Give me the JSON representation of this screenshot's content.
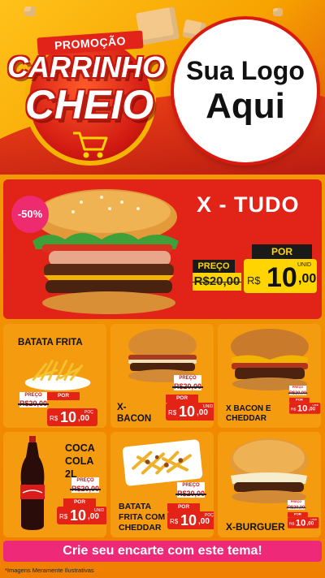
{
  "header": {
    "promo_ribbon": "PROMOÇÃO",
    "title_line1": "CARRINHO",
    "title_line2": "CHEIO",
    "logo_line1": "Sua Logo",
    "logo_line2": "Aqui"
  },
  "featured": {
    "discount": "-50%",
    "name": "X - TUDO",
    "old_label": "PREÇO",
    "old_price": "R$20,00",
    "new_label": "POR",
    "currency": "R$",
    "price_int": "10",
    "price_dec": ",00",
    "unit": "UNID"
  },
  "products": [
    {
      "name": "BATATA FRITA",
      "plabel": "PREÇO",
      "pold": "R$20,00",
      "por": "POR",
      "cur": "R$",
      "int": "10",
      "dec": ",00",
      "unit": "POÇ"
    },
    {
      "name": "X-BACON",
      "name_l1": "X-",
      "name_l2": "BACON",
      "plabel": "PREÇO",
      "pold": "R$20,00",
      "por": "POR",
      "cur": "R$",
      "int": "10",
      "dec": ",00",
      "unit": "UNID"
    },
    {
      "name_l1": "X BACON E",
      "name_l2": "CHEDDAR",
      "plabel": "PREÇO",
      "pold": "R$20,00",
      "por": "POR",
      "cur": "R$",
      "int": "10",
      "dec": ",00",
      "unit": "UNID"
    },
    {
      "name_l1": "COCA",
      "name_l2": "COLA 2L",
      "plabel": "PREÇO",
      "pold": "R$20,00",
      "por": "POR",
      "cur": "R$",
      "int": "10",
      "dec": ",00",
      "unit": "UNID"
    },
    {
      "name_l1": "BATATA",
      "name_l2": "FRITA COM",
      "name_l3": "CHEDDAR",
      "plabel": "PREÇO",
      "pold": "R$20,00",
      "por": "POR",
      "cur": "R$",
      "int": "10",
      "dec": ",00",
      "unit": "POÇ"
    },
    {
      "name": "X-BURGUER",
      "plabel": "PREÇO",
      "pold": "R$20,00",
      "por": "POR",
      "cur": "R$",
      "int": "10",
      "dec": ",00",
      "unit": "UNID"
    }
  ],
  "footer": {
    "cta": "Crie seu encarte com este tema!",
    "disclaimer": "*Imagens Meramente Ilustrativas"
  },
  "colors": {
    "brand_red": "#e22317",
    "brand_yellow": "#ffd400",
    "cta_pink": "#ee2a78",
    "card_orange": "#f59b10"
  }
}
